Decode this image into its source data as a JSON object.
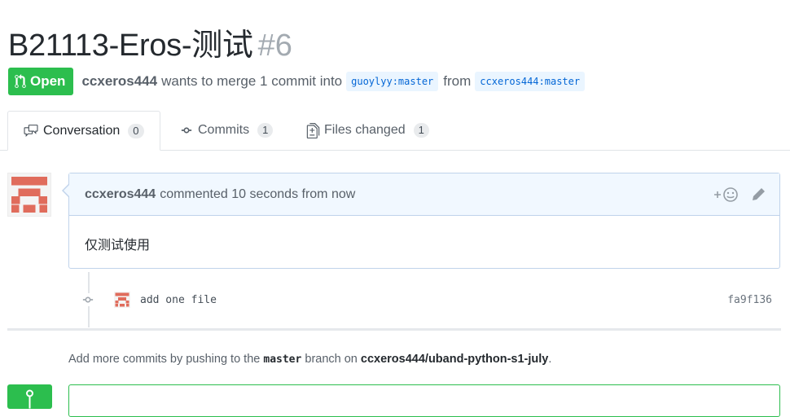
{
  "pr": {
    "title": "B21113-Eros-测试",
    "number": "#6",
    "state": "Open",
    "author": "ccxeros444",
    "merge_text": "wants to merge 1 commit into",
    "base_branch": "guoylyy:master",
    "from_text": "from",
    "head_branch": "ccxeros444:master"
  },
  "tabs": [
    {
      "label": "Conversation",
      "count": "0",
      "icon": "comment-discussion-icon"
    },
    {
      "label": "Commits",
      "count": "1",
      "icon": "git-commit-icon"
    },
    {
      "label": "Files changed",
      "count": "1",
      "icon": "file-diff-icon"
    }
  ],
  "comment": {
    "author": "ccxeros444",
    "timestamp": "commented 10 seconds from now",
    "body": "仅测试使用",
    "actions": [
      "add-reaction-icon",
      "pencil-icon"
    ]
  },
  "commit": {
    "message": "add one file",
    "sha": "fa9f136"
  },
  "help": {
    "prefix": "Add more commits by pushing to the",
    "branch": "master",
    "middle": "branch on",
    "repo": "ccxeros444/uband-python-s1-july",
    "suffix": "."
  },
  "colors": {
    "open_green": "#2cbe4e",
    "branch_bg": "#eaf5ff",
    "branch_fg": "#0366d6",
    "comment_header_bg": "#f1f8ff",
    "avatar_red": "#e06c5c"
  }
}
